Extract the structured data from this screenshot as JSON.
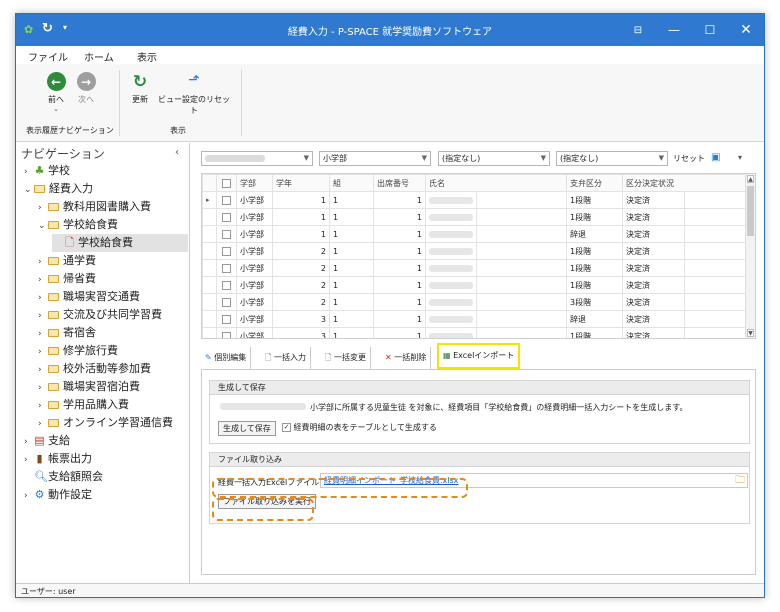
{
  "window": {
    "title": "経費入力 - P-SPACE 就学奨励費ソフトウェア"
  },
  "menu": {
    "file": "ファイル",
    "home": "ホーム",
    "view": "表示"
  },
  "ribbon": {
    "back": "前へ",
    "forward": "次へ",
    "refresh": "更新",
    "reset_view": "ビュー設定のリセット",
    "group_history": "表示履歴ナビゲーション",
    "group_view": "表示"
  },
  "nav": {
    "title": "ナビゲーション",
    "items": [
      "学校",
      "経費入力",
      "教科用図書購入費",
      "学校給食費",
      "学校給食費",
      "通学費",
      "帰省費",
      "職場実習交通費",
      "交流及び共同学習費",
      "寄宿舎",
      "修学旅行費",
      "校外活動等参加費",
      "職場実習宿泊費",
      "学用品購入費",
      "オンライン学習通信費",
      "支給",
      "帳票出力",
      "支給額照会",
      "動作設定"
    ]
  },
  "filter": {
    "department": "小学部",
    "filter2": "(指定なし)",
    "filter3": "(指定なし)",
    "reset": "リセット"
  },
  "grid": {
    "columns": [
      "学部",
      "学年",
      "組",
      "出席番号",
      "氏名",
      "支弁区分",
      "区分決定状況"
    ],
    "rows": [
      [
        "小学部",
        "1",
        "1",
        "1",
        "1段階",
        "決定済"
      ],
      [
        "小学部",
        "1",
        "1",
        "1",
        "1段階",
        "決定済"
      ],
      [
        "小学部",
        "1",
        "1",
        "1",
        "辞退",
        "決定済"
      ],
      [
        "小学部",
        "2",
        "1",
        "1",
        "1段階",
        "決定済"
      ],
      [
        "小学部",
        "2",
        "1",
        "1",
        "1段階",
        "決定済"
      ],
      [
        "小学部",
        "2",
        "1",
        "1",
        "1段階",
        "決定済"
      ],
      [
        "小学部",
        "2",
        "1",
        "1",
        "3段階",
        "決定済"
      ],
      [
        "小学部",
        "3",
        "1",
        "1",
        "辞退",
        "決定済"
      ],
      [
        "小学部",
        "3",
        "1",
        "1",
        "1段階",
        "決定済"
      ]
    ]
  },
  "tabs": {
    "individual": "個別編集",
    "bulk_input": "一括入力",
    "bulk_change": "一括変更",
    "bulk_delete": "一括削除",
    "excel_import": "Excelインポート"
  },
  "generate": {
    "header": "生成して保存",
    "description": "小学部に所属する児童生徒 を対象に、経費項目「学校給食費」の経費明細一括入力シートを生成します。",
    "button": "生成して保存",
    "checkbox_label": "経費明細の表をテーブルとして生成する"
  },
  "import": {
    "header": "ファイル取り込み",
    "file_label": "経費一括入力Excelファイル",
    "file_value": "経費明細インポート_学校給食費.xlsx",
    "button": "ファイル取り込みを実行"
  },
  "status": {
    "user": "ユーザー: user"
  },
  "colors": {
    "title_bar": "#2f7ad0",
    "highlight": "#e58a1a",
    "tab_highlight": "#f2e600"
  }
}
